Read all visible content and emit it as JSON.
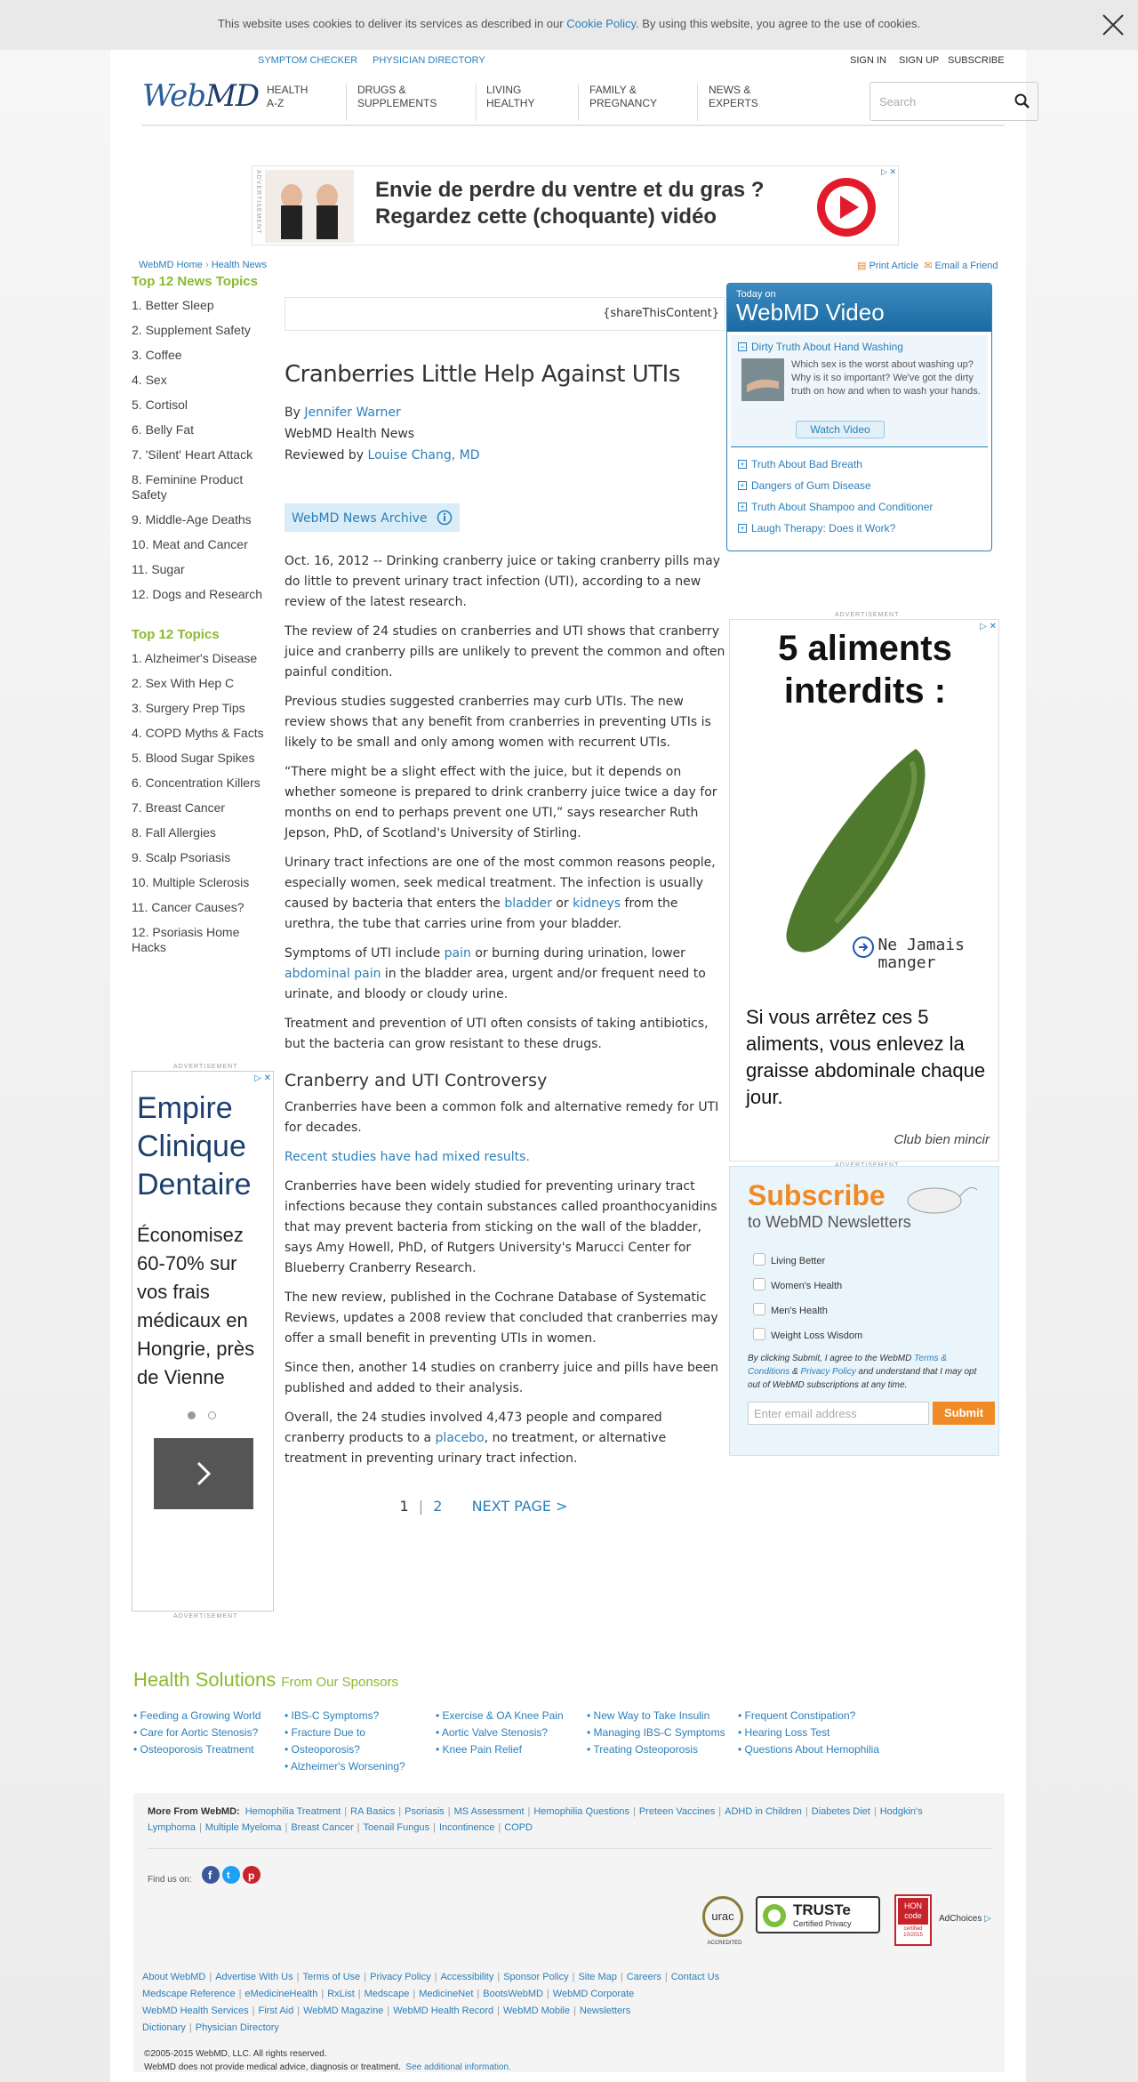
{
  "cookie": {
    "text_before": "This website uses cookies to deliver its services as described in our",
    "link": "Cookie Policy",
    "text_after": ". By using this website, you agree to the use of cookies."
  },
  "header": {
    "top_links": [
      "SYMPTOM CHECKER",
      "PHYSICIAN DIRECTORY"
    ],
    "account": [
      "SIGN IN",
      "SIGN UP",
      "SUBSCRIBE"
    ],
    "logo_a": "Web",
    "logo_b": "MD",
    "nav": [
      {
        "l1": "HEALTH",
        "l2": "A-Z"
      },
      {
        "l1": "DRUGS &",
        "l2": "SUPPLEMENTS"
      },
      {
        "l1": "LIVING",
        "l2": "HEALTHY"
      },
      {
        "l1": "FAMILY &",
        "l2": "PREGNANCY"
      },
      {
        "l1": "NEWS &",
        "l2": "EXPERTS"
      }
    ],
    "search_placeholder": "Search"
  },
  "top_ad": {
    "label": "ADVERTISEMENT",
    "line1": "Envie de perdre du ventre et du gras ?",
    "line2": "Regardez cette (choquante) vidéo"
  },
  "breadcrumb": {
    "home": "WebMD Home",
    "section": "Health News"
  },
  "tools": {
    "print": "Print Article",
    "email": "Email a Friend"
  },
  "left": {
    "news_title": "Top 12 News Topics",
    "news": [
      "1. Better Sleep",
      "2. Supplement Safety",
      "3. Coffee",
      "4. Sex",
      "5. Cortisol",
      "6. Belly Fat",
      "7. 'Silent' Heart Attack",
      "8. Feminine Product Safety",
      "9. Middle-Age Deaths",
      "10. Meat and Cancer",
      "11. Sugar",
      "12. Dogs and Research"
    ],
    "topics_title": "Top 12 Topics",
    "topics": [
      "1. Alzheimer's Disease",
      "2. Sex With Hep C",
      "3. Surgery Prep Tips",
      "4. COPD Myths & Facts",
      "5. Blood Sugar Spikes",
      "6. Concentration Killers",
      "7. Breast Cancer",
      "8. Fall Allergies",
      "9. Scalp Psoriasis",
      "10. Multiple Sclerosis",
      "11. Cancer Causes?",
      "12. Psoriasis Home Hacks"
    ],
    "ad": {
      "label": "ADVERTISEMENT",
      "title": "Empire Clinique Dentaire",
      "body": "Économisez 60-70% sur vos frais médicaux en Hongrie, près de Vienne"
    }
  },
  "article": {
    "share": "{shareThisContent}",
    "title": "Cranberries Little Help Against UTIs",
    "by": "By",
    "author": "Jennifer Warner",
    "outlet": "WebMD Health News",
    "reviewed": "Reviewed by",
    "reviewer": "Louise Chang, MD",
    "archive": "WebMD News Archive",
    "p1": "Oct. 16, 2012 -- Drinking cranberry juice or taking cranberry pills may do little to prevent urinary tract infection (UTI), according to a new review of the latest research.",
    "p2": "The review of 24 studies on cranberries and UTI shows that cranberry juice and cranberry pills are unlikely to prevent the common and often painful condition.",
    "p3": "Previous studies suggested cranberries may curb UTIs. The new review shows that any benefit from cranberries in preventing UTIs is likely to be small and only among women with recurrent UTIs.",
    "p4": "“There might be a slight effect with the juice, but it depends on whether someone is prepared to drink cranberry juice twice a day for months on end to perhaps prevent one UTI,” says researcher Ruth Jepson, PhD, of Scotland's University of Stirling.",
    "p5a": "Urinary tract infections are one of the most common reasons people, especially women, seek medical treatment. The infection is usually caused by bacteria that enters the",
    "p5_link1": "bladder",
    "p5_or": "or",
    "p5_link2": "kidneys",
    "p5b": "from the urethra, the tube that carries urine from your bladder.",
    "p6a": "Symptoms of UTI include",
    "p6_link1": "pain",
    "p6b": "or burning during urination, lower",
    "p6_link2": "abdominal pain",
    "p6c": "in the bladder area, urgent and/or frequent need to urinate, and bloody or cloudy urine.",
    "p7": "Treatment and prevention of UTI often consists of taking antibiotics, but the bacteria can grow resistant to these drugs.",
    "subhead": "Cranberry and UTI Controversy",
    "p8": "Cranberries have been a common folk and alternative remedy for UTI for decades.",
    "p9_link": "Recent studies have had mixed results.",
    "p10": "Cranberries have been widely studied for preventing urinary tract infections because they contain substances called proanthocyanidins that may prevent bacteria from sticking on the wall of the bladder, says Amy Howell, PhD, of Rutgers University's Marucci Center for Blueberry Cranberry Research.",
    "p11": "The new review, published in the Cochrane Database of Systematic Reviews, updates a 2008 review that concluded that cranberries may offer a small benefit in preventing UTIs in women.",
    "p12": "Since then, another 14 studies on cranberry juice and pills have been published and added to their analysis.",
    "p13a": "Overall, the 24 studies involved 4,473 people and compared cranberry products to a",
    "p13_link": "placebo",
    "p13b": ", no treatment, or alternative treatment in preventing urinary tract infection.",
    "page1": "1",
    "page2": "2",
    "next": "NEXT PAGE >"
  },
  "video": {
    "small": "Today on",
    "big": "WebMD Video",
    "feature_title": "Dirty Truth About Hand Washing",
    "feature_text": "Which sex is the worst about washing up? Why is it so important? We've got the dirty truth on how and when to wash your hands.",
    "watch": "Watch Video",
    "links": [
      "Truth About Bad Breath",
      "Dangers of Gum Disease",
      "Truth About Shampoo and Conditioner",
      "Laugh Therapy: Does it Work?"
    ]
  },
  "right_ad": {
    "label": "ADVERTISEMENT",
    "title": "5 aliments interdits :",
    "tag": "Ne Jamais manger",
    "body": "Si vous arrêtez ces 5 aliments, vous enlevez la graisse abdominale chaque jour.",
    "brand": "Club bien mincir"
  },
  "subscribe": {
    "title": "Subscribe",
    "subtitle": "to WebMD Newsletters",
    "options": [
      "Living Better",
      "Women's Health",
      "Men's Health",
      "Weight Loss Wisdom"
    ],
    "legal_a": "By clicking Submit, I agree to the WebMD",
    "terms": "Terms & Conditions",
    "amp": "&",
    "privacy": "Privacy Policy",
    "legal_b": "and understand that I may opt out of WebMD subscriptions at any time.",
    "email_placeholder": "Enter email address",
    "submit": "Submit"
  },
  "health_solutions": {
    "title": "Health Solutions",
    "from": "From Our Sponsors",
    "cols": [
      [
        "Feeding a Growing World",
        "Care for Aortic Stenosis?",
        "Osteoporosis Treatment"
      ],
      [
        "IBS-C Symptoms?",
        "Fracture Due to",
        "Osteoporosis?",
        "Alzheimer's Worsening?"
      ],
      [
        "Exercise & OA Knee Pain",
        "Aortic Valve Stenosis?",
        "Knee Pain Relief"
      ],
      [
        "New Way to Take Insulin",
        "Managing IBS-C Symptoms",
        "Treating Osteoporosis"
      ],
      [
        "Frequent Constipation?",
        "Hearing Loss Test",
        "Questions About Hemophilia"
      ]
    ]
  },
  "footer": {
    "more_label": "More From WebMD:",
    "more": [
      "Hemophilia Treatment",
      "RA Basics",
      "Psoriasis",
      "MS Assessment",
      "Hemophilia Questions",
      "Preteen Vaccines",
      "ADHD in Children",
      "Diabetes Diet",
      "Hodgkin's Lymphoma",
      "Multiple Myeloma",
      "Breast Cancer",
      "Toenail Fungus",
      "Incontinence",
      "COPD"
    ],
    "find_us": "Find us on:",
    "badges": {
      "urac": "urac",
      "urac_sub": "ACCREDITED",
      "truste": "TRUSTe",
      "truste_sub": "Certified Privacy",
      "hon": "HON code",
      "hon_sub": "certified 10/2015",
      "adchoices": "AdChoices"
    },
    "links1": [
      "About WebMD",
      "Advertise With Us",
      "Terms of Use",
      "Privacy Policy",
      "Accessibility",
      "Sponsor Policy",
      "Site Map",
      "Careers",
      "Contact Us"
    ],
    "links2": [
      "Medscape Reference",
      "eMedicineHealth",
      "RxList",
      "Medscape",
      "MedicineNet",
      "BootsWebMD",
      "WebMD Corporate"
    ],
    "links3": [
      "WebMD Health Services",
      "First Aid",
      "WebMD Magazine",
      "WebMD Health Record",
      "WebMD Mobile",
      "Newsletters"
    ],
    "links4": [
      "Dictionary",
      "Physician Directory"
    ],
    "copyright": "©2005-2015 WebMD, LLC. All rights reserved.",
    "disclaimer": "WebMD does not provide medical advice, diagnosis or treatment.",
    "see_more": "See additional information."
  }
}
